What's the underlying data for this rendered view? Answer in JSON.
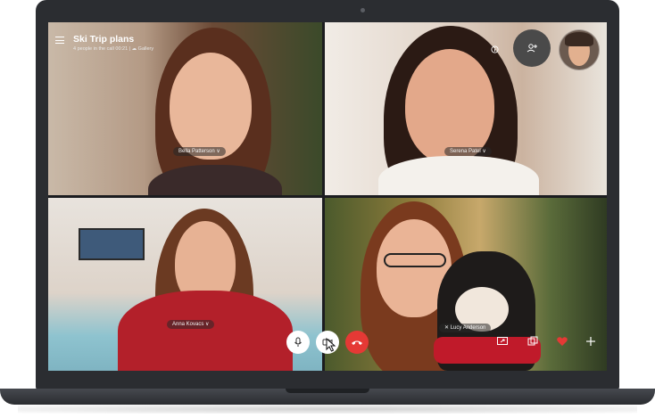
{
  "call": {
    "title": "Ski Trip plans",
    "subtitle": "4 people in the call 00:21 | ☁ Gallery"
  },
  "participants": [
    {
      "name": "Bella Patterson ∨"
    },
    {
      "name": "Serena Patel ∨"
    },
    {
      "name": "Anna Kovacs ∨"
    },
    {
      "name": "✕ Lucy Anderson"
    }
  ],
  "icons": {
    "menu": "menu-icon",
    "add_person": "add-person-icon",
    "info": "info-icon",
    "mic": "microphone-icon",
    "video": "video-camera-icon",
    "end_call": "end-call-icon",
    "screen_share": "screen-share-icon",
    "switch_view": "switch-view-icon",
    "heart": "heart-icon",
    "add": "plus-icon"
  },
  "colors": {
    "end_call": "#e53935",
    "heart": "#e53935"
  }
}
